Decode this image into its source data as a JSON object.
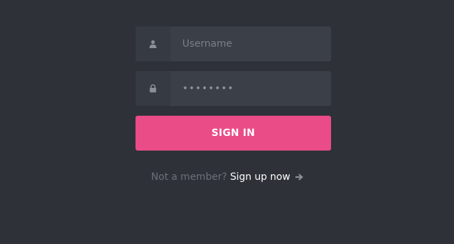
{
  "login": {
    "username_placeholder": "Username",
    "password_value": "••••••••",
    "signin_label": "SIGN IN",
    "footer_prompt": "Not a member?",
    "signup_label": "Sign up now"
  },
  "icons": {
    "username": "user-icon",
    "password": "lock-icon",
    "signup_arrow": "arrow-right-icon"
  },
  "colors": {
    "background": "#2e3138",
    "field_icon_bg": "#363a42",
    "field_bg": "#3b3f47",
    "accent": "#ea4c88",
    "muted_text": "#6c717a",
    "link_text": "#ffffff"
  }
}
